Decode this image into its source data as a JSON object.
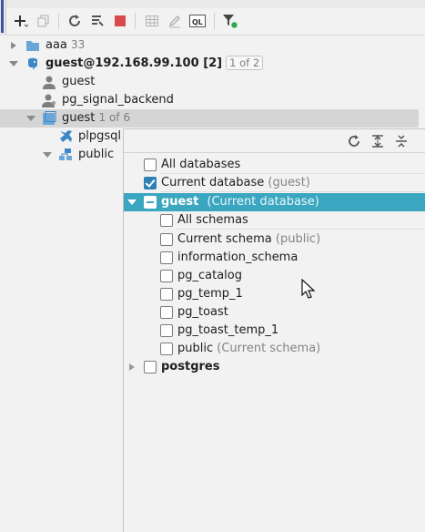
{
  "toolbar": {
    "buttons": [
      {
        "name": "add-icon",
        "label": "+"
      },
      {
        "name": "duplicate-icon"
      },
      {
        "name": "refresh-icon"
      },
      {
        "name": "schema-settings-icon"
      },
      {
        "name": "stop-icon",
        "color": "#db4a4a"
      },
      {
        "name": "table-icon"
      },
      {
        "name": "edit-icon"
      },
      {
        "name": "ql-console-icon",
        "label": "QL"
      },
      {
        "name": "filter-icon",
        "badge_color": "#2fa84f"
      }
    ]
  },
  "tree": {
    "items": [
      {
        "label": "aaa",
        "count": "33"
      },
      {
        "label": "guest@192.168.99.100",
        "suffix": "[2]",
        "badge": "1 of 2"
      },
      {
        "label": "guest"
      },
      {
        "label": "pg_signal_backend"
      },
      {
        "label": "guest",
        "count": "1 of 6"
      },
      {
        "label": "plpgsql"
      },
      {
        "label": "public"
      }
    ]
  },
  "popup": {
    "toolbar": [
      {
        "name": "refresh-icon"
      },
      {
        "name": "expand-all-icon"
      },
      {
        "name": "collapse-all-icon"
      }
    ],
    "rows": [
      {
        "label": "All databases",
        "note": "",
        "checked": false
      },
      {
        "label": "Current database",
        "note": "(guest)",
        "checked": true
      },
      {
        "label": "guest",
        "note": "(Current database)",
        "checked": "partial"
      },
      {
        "label": "All schemas",
        "note": "",
        "checked": false
      },
      {
        "label": "Current schema",
        "note": "(public)",
        "checked": false
      },
      {
        "label": "information_schema",
        "note": "",
        "checked": false
      },
      {
        "label": "pg_catalog",
        "note": "",
        "checked": false
      },
      {
        "label": "pg_temp_1",
        "note": "",
        "checked": false
      },
      {
        "label": "pg_toast",
        "note": "",
        "checked": false
      },
      {
        "label": "pg_toast_temp_1",
        "note": "",
        "checked": false
      },
      {
        "label": "public",
        "note": "(Current schema)",
        "checked": false
      },
      {
        "label": "postgres",
        "note": "",
        "checked": false
      }
    ]
  },
  "colors": {
    "highlight": "#3aa6bf",
    "checkbox_checked": "#2e7fb3",
    "folder": "#6aa7d8",
    "elephant": "#3d87c9"
  }
}
